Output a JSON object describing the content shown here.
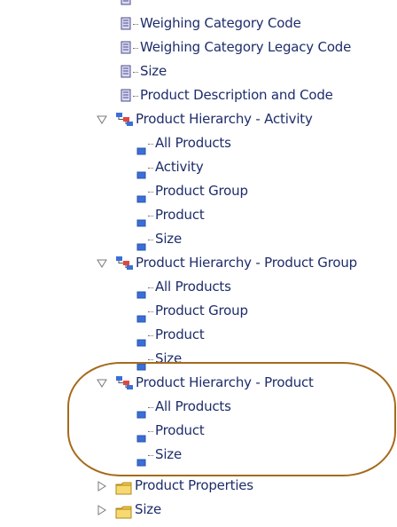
{
  "tree": {
    "attributes": [
      {
        "label": "Weighing Category Code"
      },
      {
        "label": "Weighing Category Legacy Code"
      },
      {
        "label": "Size"
      },
      {
        "label": "Product Description and Code"
      }
    ],
    "hierarchies": [
      {
        "label": "Product Hierarchy - Activity",
        "expanded": true,
        "levels": [
          "All Products",
          "Activity",
          "Product Group",
          "Product",
          "Size"
        ]
      },
      {
        "label": "Product Hierarchy - Product Group",
        "expanded": true,
        "levels": [
          "All Products",
          "Product Group",
          "Product",
          "Size"
        ]
      },
      {
        "label": "Product Hierarchy - Product",
        "expanded": true,
        "highlighted": true,
        "levels": [
          "All Products",
          "Product",
          "Size"
        ]
      }
    ],
    "folders": [
      {
        "label": "Product Properties",
        "expanded": false
      },
      {
        "label": "Size",
        "expanded": false
      }
    ]
  },
  "colors": {
    "text": "#1e2d6b",
    "highlight_outline": "#a66a1c",
    "level_icon": "#3a6fd8",
    "folder": "#f2c648"
  }
}
